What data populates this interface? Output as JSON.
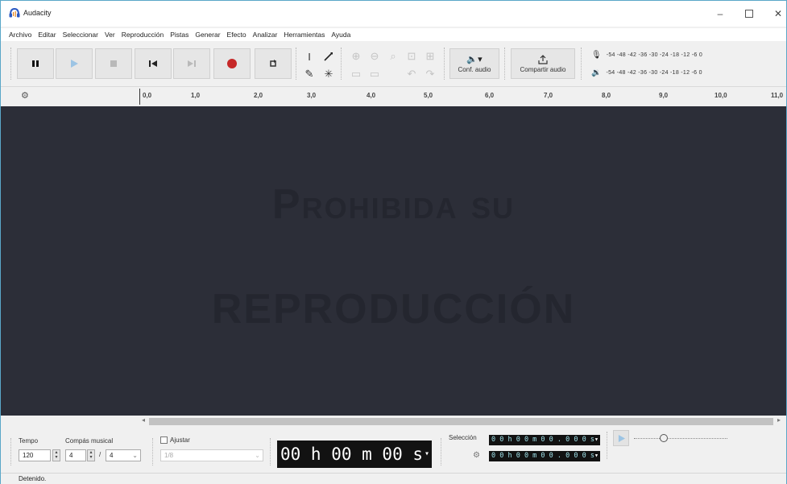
{
  "window": {
    "title": "Audacity"
  },
  "menu": [
    "Archivo",
    "Editar",
    "Seleccionar",
    "Ver",
    "Reproducción",
    "Pistas",
    "Generar",
    "Efecto",
    "Analizar",
    "Herramientas",
    "Ayuda"
  ],
  "toolbar": {
    "audio_setup_label": "Conf. audio",
    "share_audio_label": "Compartir audio",
    "meter_scale": "-54 -48 -42 -36 -30 -24 -18 -12 -6 0"
  },
  "timeline": {
    "ticks": [
      "0,0",
      "1,0",
      "2,0",
      "3,0",
      "4,0",
      "5,0",
      "6,0",
      "7,0",
      "8,0",
      "9,0",
      "10,0",
      "11,0"
    ]
  },
  "watermark": {
    "line1": "Prohibida su",
    "line2": "reproducción"
  },
  "bottom": {
    "tempo_label": "Tempo",
    "tempo_value": "120",
    "time_signature_label": "Compás musical",
    "time_signature_upper": "4",
    "time_signature_lower": "4",
    "snap_label": "Ajustar",
    "snap_value": "1/8",
    "time_display": "00 h 00 m 00 s",
    "selection_label": "Selección",
    "selection_start": "0 0 h 0 0 m 0 0 . 0 0 0 s",
    "selection_end": "0 0 h 0 0 m 0 0 . 0 0 0 s"
  },
  "status": {
    "text": "Detenido."
  },
  "colors": {
    "track_bg": "#2c2e38",
    "record_red": "#c62828",
    "accent": "#5aa7c8"
  },
  "icons": [
    "headphones-icon",
    "minimize-icon",
    "maximize-icon",
    "close-icon",
    "pause-icon",
    "play-icon",
    "stop-icon",
    "skip-start-icon",
    "skip-end-icon",
    "record-icon",
    "loop-icon",
    "selection-tool-icon",
    "envelope-tool-icon",
    "draw-tool-icon",
    "multi-tool-icon",
    "speaker-icon",
    "share-icon",
    "microphone-icon",
    "gear-icon"
  ]
}
